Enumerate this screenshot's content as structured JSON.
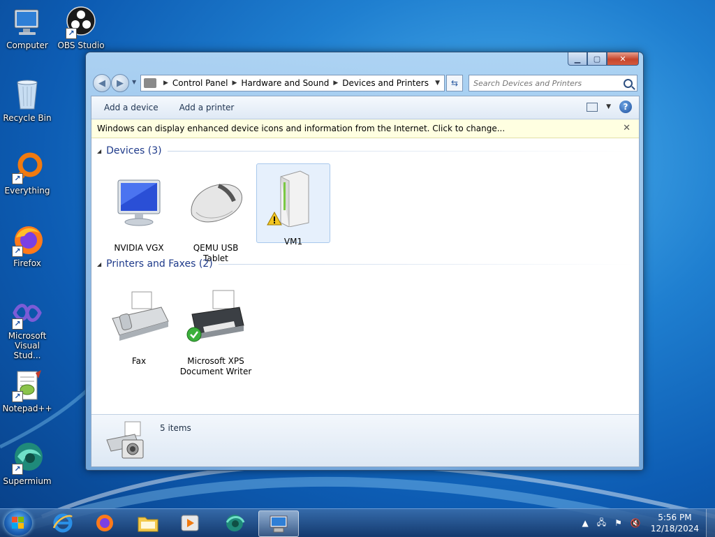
{
  "desktop": {
    "icons": [
      {
        "label": "Computer"
      },
      {
        "label": "OBS Studio"
      },
      {
        "label": "Recycle Bin"
      },
      {
        "label": "Everything"
      },
      {
        "label": "Firefox"
      },
      {
        "label": "Microsoft Visual Stud..."
      },
      {
        "label": "Notepad++"
      },
      {
        "label": "Supermium"
      }
    ]
  },
  "window": {
    "breadcrumb": [
      "Control Panel",
      "Hardware and Sound",
      "Devices and Printers"
    ],
    "search_placeholder": "Search Devices and Printers",
    "toolbar": {
      "add_device": "Add a device",
      "add_printer": "Add a printer"
    },
    "infobar": "Windows can display enhanced device icons and information from the Internet. Click to change...",
    "groups": {
      "devices": {
        "title": "Devices (3)",
        "items": [
          {
            "name": "NVIDIA VGX",
            "icon": "monitor-icon"
          },
          {
            "name": "QEMU USB Tablet",
            "icon": "mouse-icon"
          },
          {
            "name": "VM1",
            "icon": "computer-tower-icon",
            "warning": true
          }
        ]
      },
      "printers": {
        "title": "Printers and Faxes (2)",
        "items": [
          {
            "name": "Fax",
            "icon": "fax-icon"
          },
          {
            "name": "Microsoft XPS Document Writer",
            "icon": "printer-icon",
            "default": true
          }
        ]
      }
    },
    "details": {
      "count": "5 items"
    }
  },
  "taskbar": {
    "clock_time": "5:56 PM",
    "clock_date": "12/18/2024"
  },
  "colors": {
    "accent": "#1e3a8a",
    "infobar_bg": "#ffffe1",
    "close_red": "#c6452b"
  }
}
